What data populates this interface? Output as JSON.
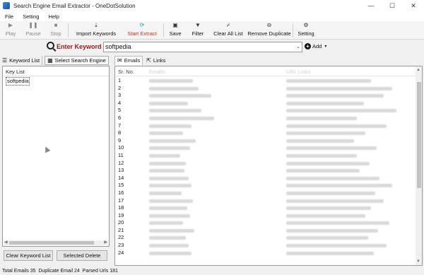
{
  "window": {
    "title": "Search Engine Email Extractor",
    "publisher": "OneDotSolution",
    "minimize": "—",
    "maximize": "☐",
    "close": "✕"
  },
  "menu": [
    "File",
    "Setting",
    "Help"
  ],
  "toolbar": {
    "play": "Play",
    "pause": "Pause",
    "stop": "Stop",
    "import_keywords": "Import Keywords",
    "start_extract": "Start Extract",
    "save": "Save",
    "filter": "Filter",
    "clear_all_list": "Clear All List",
    "remove_duplicate": "Remove Duplicate",
    "setting": "Setting"
  },
  "keyword_bar": {
    "label": "Enter Keyword",
    "value": "softpedia",
    "add": "Add"
  },
  "left_tabs": {
    "keyword_list": "Keyword List",
    "select_engine": "Select Search Engine"
  },
  "key_list": {
    "header": "Key List",
    "items": [
      "softpedia"
    ]
  },
  "left_buttons": {
    "clear": "Clear Keyword List",
    "delete": "Selected Delete"
  },
  "right_tabs": {
    "emails": "Emails",
    "links": "Links"
  },
  "table": {
    "columns": [
      "Sr. No.",
      "Emails",
      "URL Links"
    ],
    "rows": [
      "1",
      "2",
      "3",
      "4",
      "5",
      "6",
      "7",
      "8",
      "9",
      "10",
      "11",
      "12",
      "13",
      "14",
      "15",
      "16",
      "17",
      "18",
      "19",
      "20",
      "21",
      "22",
      "23",
      "24"
    ]
  },
  "status": {
    "total_emails_label": "Total Emails",
    "total_emails": "35",
    "duplicate_label": "Duplicate Email",
    "duplicate": "24",
    "parsed_label": "Parsed Urls",
    "parsed": "181"
  },
  "icons": {
    "play": "play-icon",
    "pause": "pause-icon",
    "stop": "stop-icon",
    "import": "import-icon",
    "start": "refresh-icon",
    "save": "floppy-icon",
    "filter": "filter-icon",
    "clear": "broom-icon",
    "remove": "minus-circle-icon",
    "setting": "gear-icon"
  }
}
